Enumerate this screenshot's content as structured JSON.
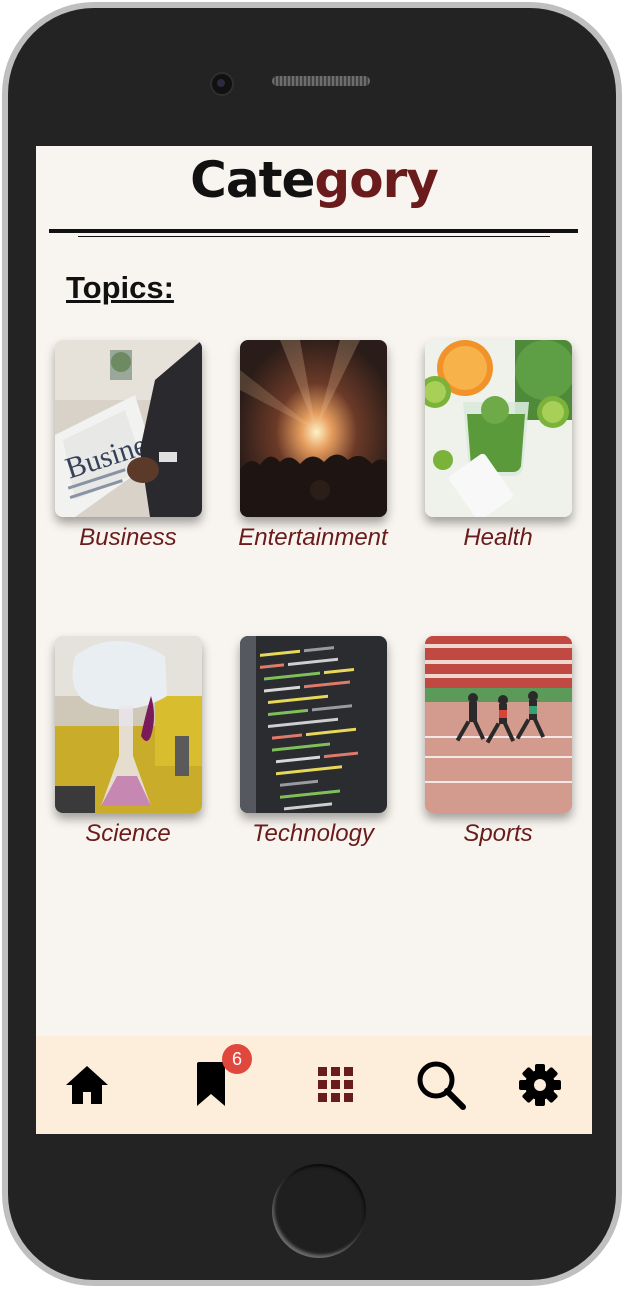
{
  "header": {
    "title_part1": "Cate",
    "title_part2": "gory"
  },
  "topics_heading": "Topics:",
  "topics": [
    {
      "label": "Business"
    },
    {
      "label": "Entertainment"
    },
    {
      "label": "Health"
    },
    {
      "label": "Science"
    },
    {
      "label": "Technology"
    },
    {
      "label": "Sports"
    }
  ],
  "nav": {
    "items": [
      {
        "icon": "home-icon"
      },
      {
        "icon": "bookmark-icon",
        "badge": "6"
      },
      {
        "icon": "grid-icon"
      },
      {
        "icon": "search-icon"
      },
      {
        "icon": "gear-icon"
      }
    ]
  },
  "colors": {
    "accent": "#6a1b1b",
    "screen_background": "#f8f4ef",
    "nav_background": "#fdeedb",
    "badge": "#e0483e"
  }
}
